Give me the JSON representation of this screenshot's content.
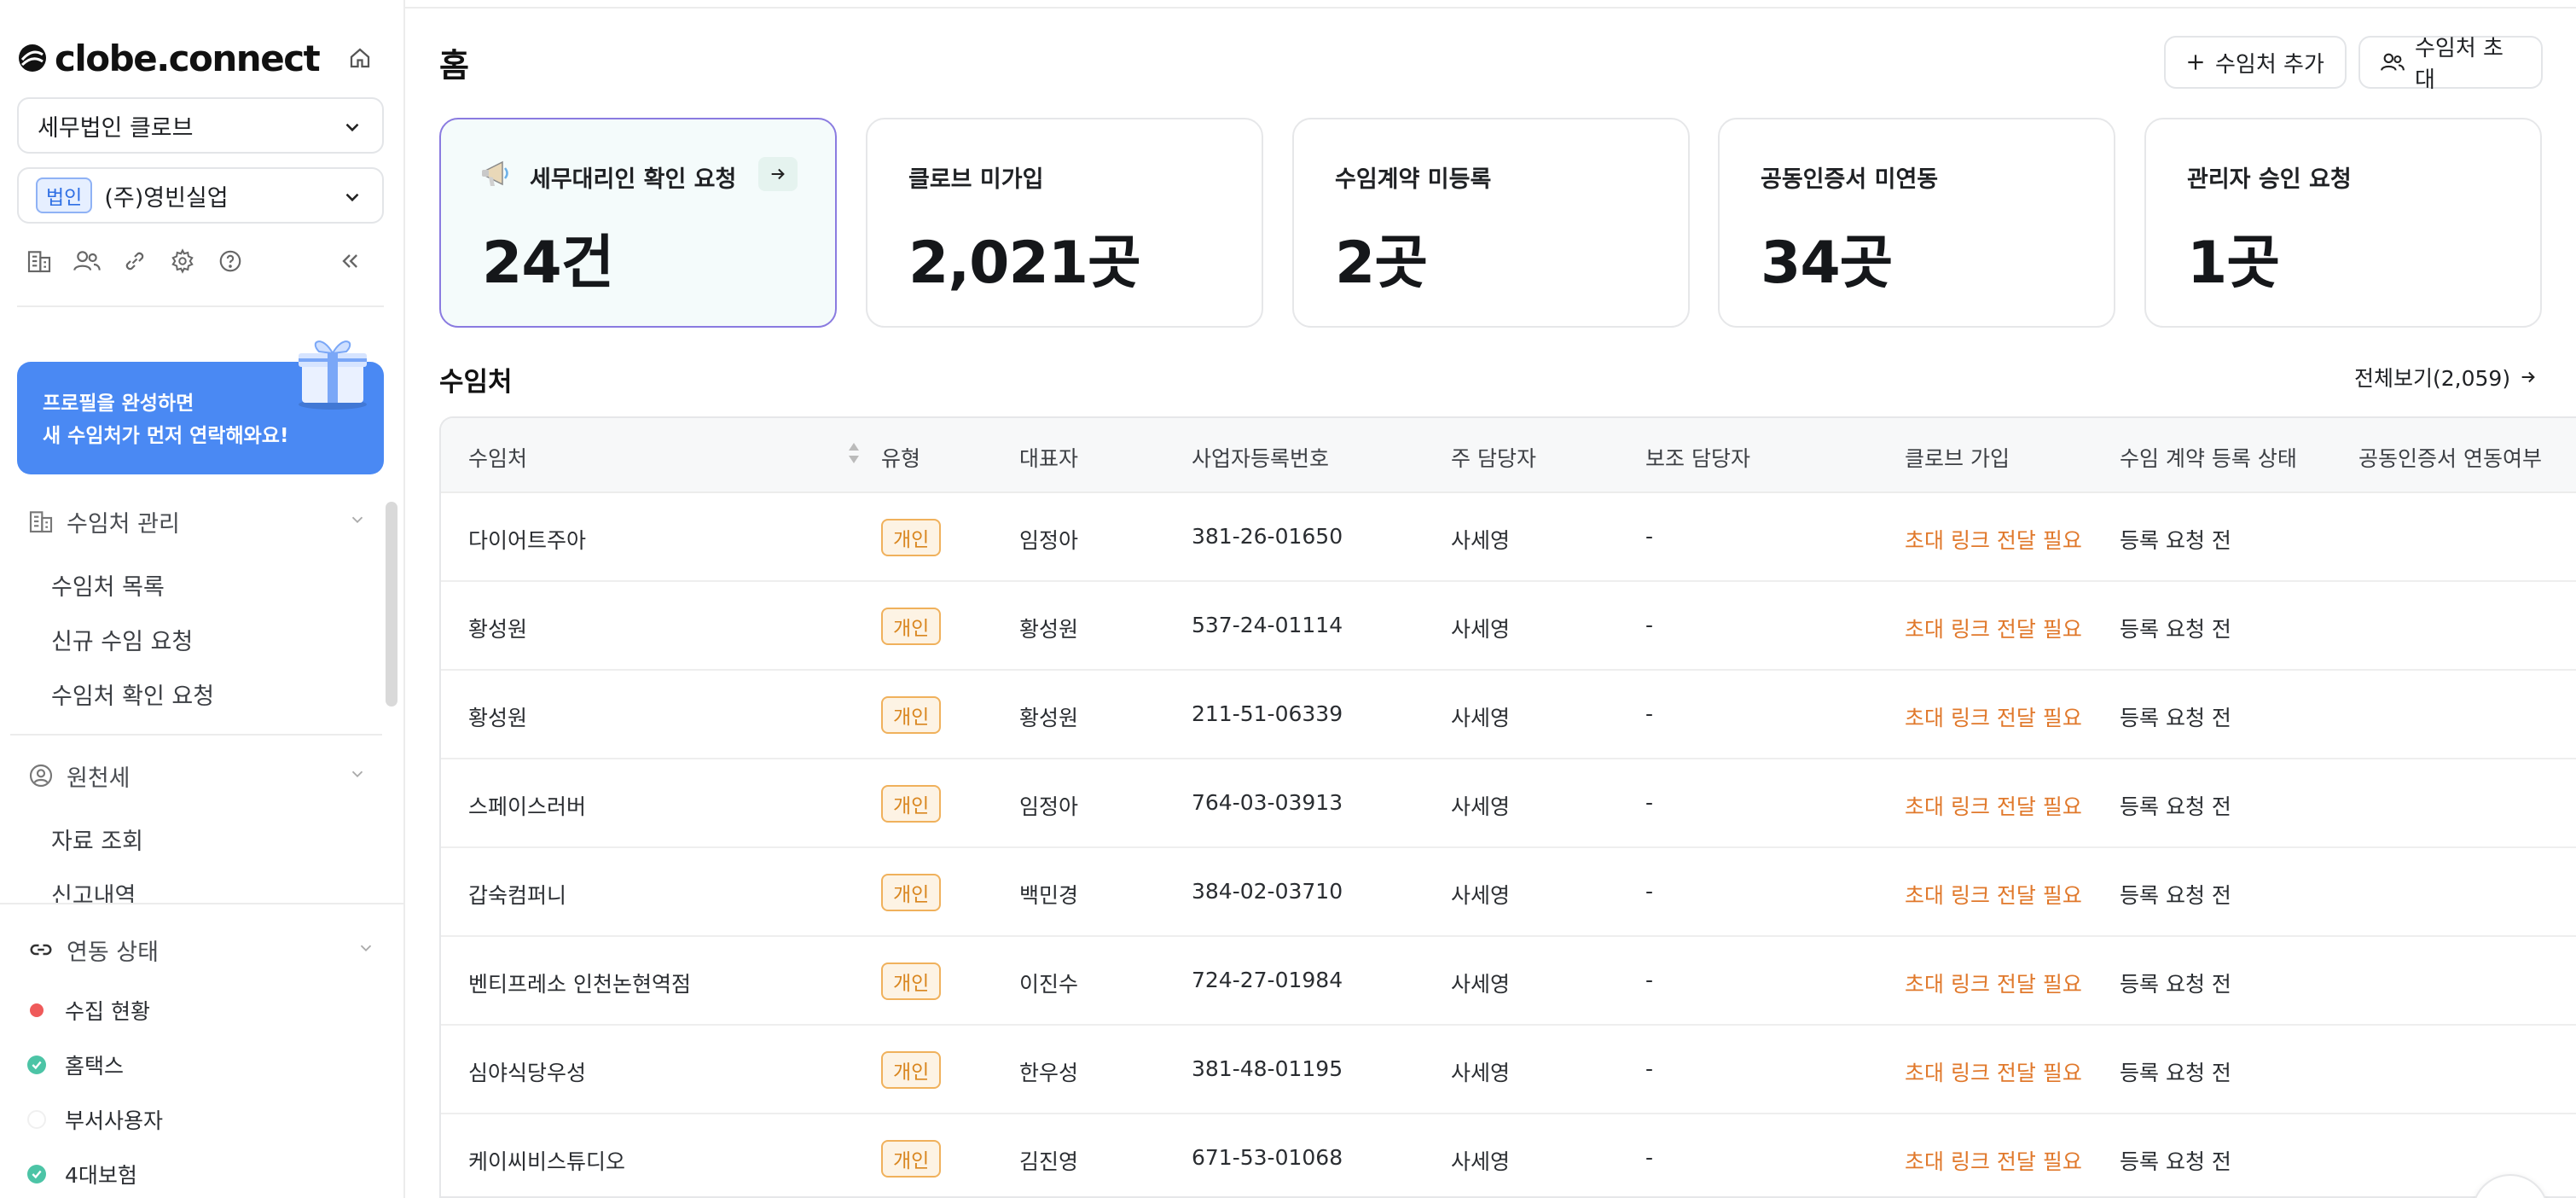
{
  "sidebar": {
    "logo_text": "clobe.connect",
    "org_select": "세무법인 클로브",
    "client_badge": "법인",
    "client_select": "(주)영빈실업",
    "promo_line1": "프로필을 완성하면",
    "promo_line2": "새 수임처가 먼저 연락해와요!",
    "menu": [
      {
        "title": "수임처 관리",
        "icon": "building-icon",
        "items": [
          "수임처 목록",
          "신규 수임 요청",
          "수임처 확인 요청"
        ]
      },
      {
        "title": "원천세",
        "icon": "user-circle-icon",
        "items": [
          "자료 조회",
          "신고내역"
        ]
      }
    ],
    "status": {
      "title": "연동 상태",
      "items": [
        {
          "label": "수집 현황",
          "state": "red"
        },
        {
          "label": "홈택스",
          "state": "green"
        },
        {
          "label": "부서사용자",
          "state": "empty"
        },
        {
          "label": "4대보험",
          "state": "green"
        }
      ]
    }
  },
  "header": {
    "title": "홈",
    "add_button": "수임처 추가",
    "invite_button": "수임처 초대"
  },
  "cards": [
    {
      "label": "세무대리인 확인 요청",
      "value": "24건"
    },
    {
      "label": "클로브 미가입",
      "value": "2,021곳"
    },
    {
      "label": "수임계약 미등록",
      "value": "2곳"
    },
    {
      "label": "공동인증서 미연동",
      "value": "34곳"
    },
    {
      "label": "관리자 승인 요청",
      "value": "1곳"
    }
  ],
  "clients": {
    "title": "수임처",
    "view_all": "전체보기(2,059)",
    "columns": [
      "수임처",
      "유형",
      "대표자",
      "사업자등록번호",
      "주 담당자",
      "보조 담당자",
      "클로브 가입",
      "수임 계약 등록 상태",
      "공동인증서 연동여부"
    ],
    "rows": [
      {
        "name": "다이어트주아",
        "type": "개인",
        "ceo": "임정아",
        "bizno": "381-26-01650",
        "main": "사세영",
        "sub": "-",
        "clobe": "초대 링크 전달 필요",
        "contract": "등록 요청 전"
      },
      {
        "name": "황성원",
        "type": "개인",
        "ceo": "황성원",
        "bizno": "537-24-01114",
        "main": "사세영",
        "sub": "-",
        "clobe": "초대 링크 전달 필요",
        "contract": "등록 요청 전"
      },
      {
        "name": "황성원",
        "type": "개인",
        "ceo": "황성원",
        "bizno": "211-51-06339",
        "main": "사세영",
        "sub": "-",
        "clobe": "초대 링크 전달 필요",
        "contract": "등록 요청 전"
      },
      {
        "name": "스페이스러버",
        "type": "개인",
        "ceo": "임정아",
        "bizno": "764-03-03913",
        "main": "사세영",
        "sub": "-",
        "clobe": "초대 링크 전달 필요",
        "contract": "등록 요청 전"
      },
      {
        "name": "갑숙컴퍼니",
        "type": "개인",
        "ceo": "백민경",
        "bizno": "384-02-03710",
        "main": "사세영",
        "sub": "-",
        "clobe": "초대 링크 전달 필요",
        "contract": "등록 요청 전"
      },
      {
        "name": "벤티프레소 인천논현역점",
        "type": "개인",
        "ceo": "이진수",
        "bizno": "724-27-01984",
        "main": "사세영",
        "sub": "-",
        "clobe": "초대 링크 전달 필요",
        "contract": "등록 요청 전"
      },
      {
        "name": "심야식당우성",
        "type": "개인",
        "ceo": "한우성",
        "bizno": "381-48-01195",
        "main": "사세영",
        "sub": "-",
        "clobe": "초대 링크 전달 필요",
        "contract": "등록 요청 전"
      },
      {
        "name": "케이씨비스튜디오",
        "type": "개인",
        "ceo": "김진영",
        "bizno": "671-53-01068",
        "main": "사세영",
        "sub": "-",
        "clobe": "초대 링크 전달 필요",
        "contract": "등록 요청 전"
      }
    ]
  },
  "colors": {
    "accent": "#4a89f3",
    "invite_orange": "#e0782b",
    "badge_orange": "#f0b15c",
    "status_green": "#4cc4a6",
    "status_red": "#ef5a5a",
    "active_card_border": "#8a7be0"
  }
}
